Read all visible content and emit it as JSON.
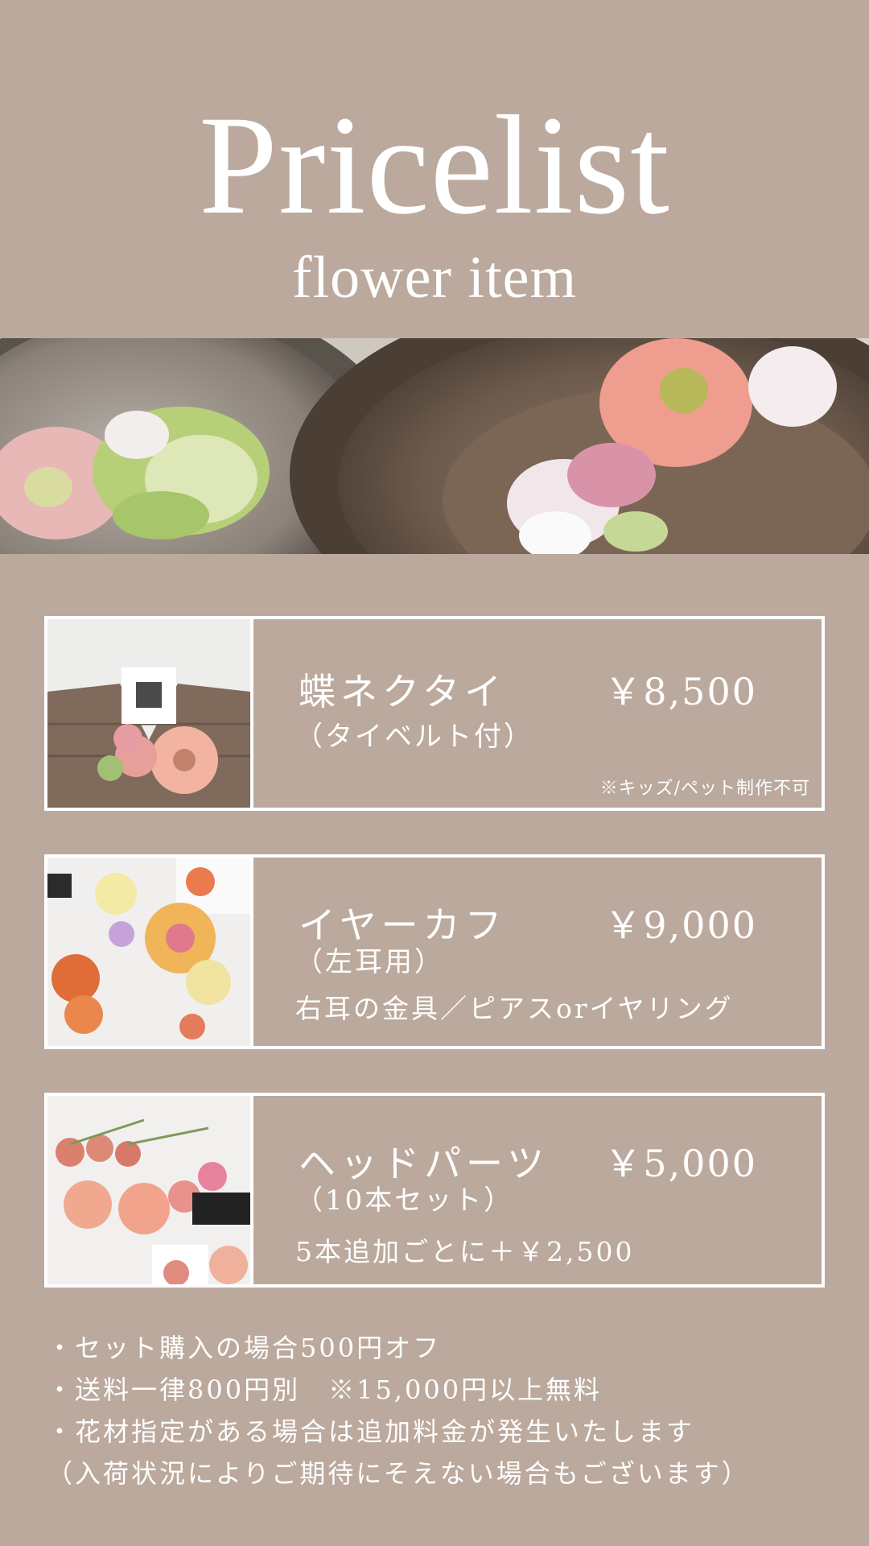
{
  "header": {
    "title": "Pricelist",
    "subtitle": "flower item"
  },
  "items": [
    {
      "name": "蝶ネクタイ",
      "price": "￥8,500",
      "sub": "（タイベルト付）",
      "note": "※キッズ/ペット制作不可",
      "extra": ""
    },
    {
      "name": "イヤーカフ",
      "price": "￥9,000",
      "sub": "（左耳用）",
      "note": "",
      "extra": "右耳の金具／ピアスorイヤリング"
    },
    {
      "name": "ヘッドパーツ",
      "price": "￥5,000",
      "sub": "（10本セット）",
      "note": "",
      "extra": "5本追加ごとに＋￥2,500"
    }
  ],
  "notes": [
    "・セット購入の場合500円オフ",
    "・送料一律800円別　※15,000円以上無料",
    "・花材指定がある場合は追加料金が発生いたします",
    "（入荷状況によりご期待にそえない場合もございます）"
  ],
  "colors": {
    "background": "#bba99d",
    "text": "#ffffff",
    "border": "#ffffff"
  }
}
